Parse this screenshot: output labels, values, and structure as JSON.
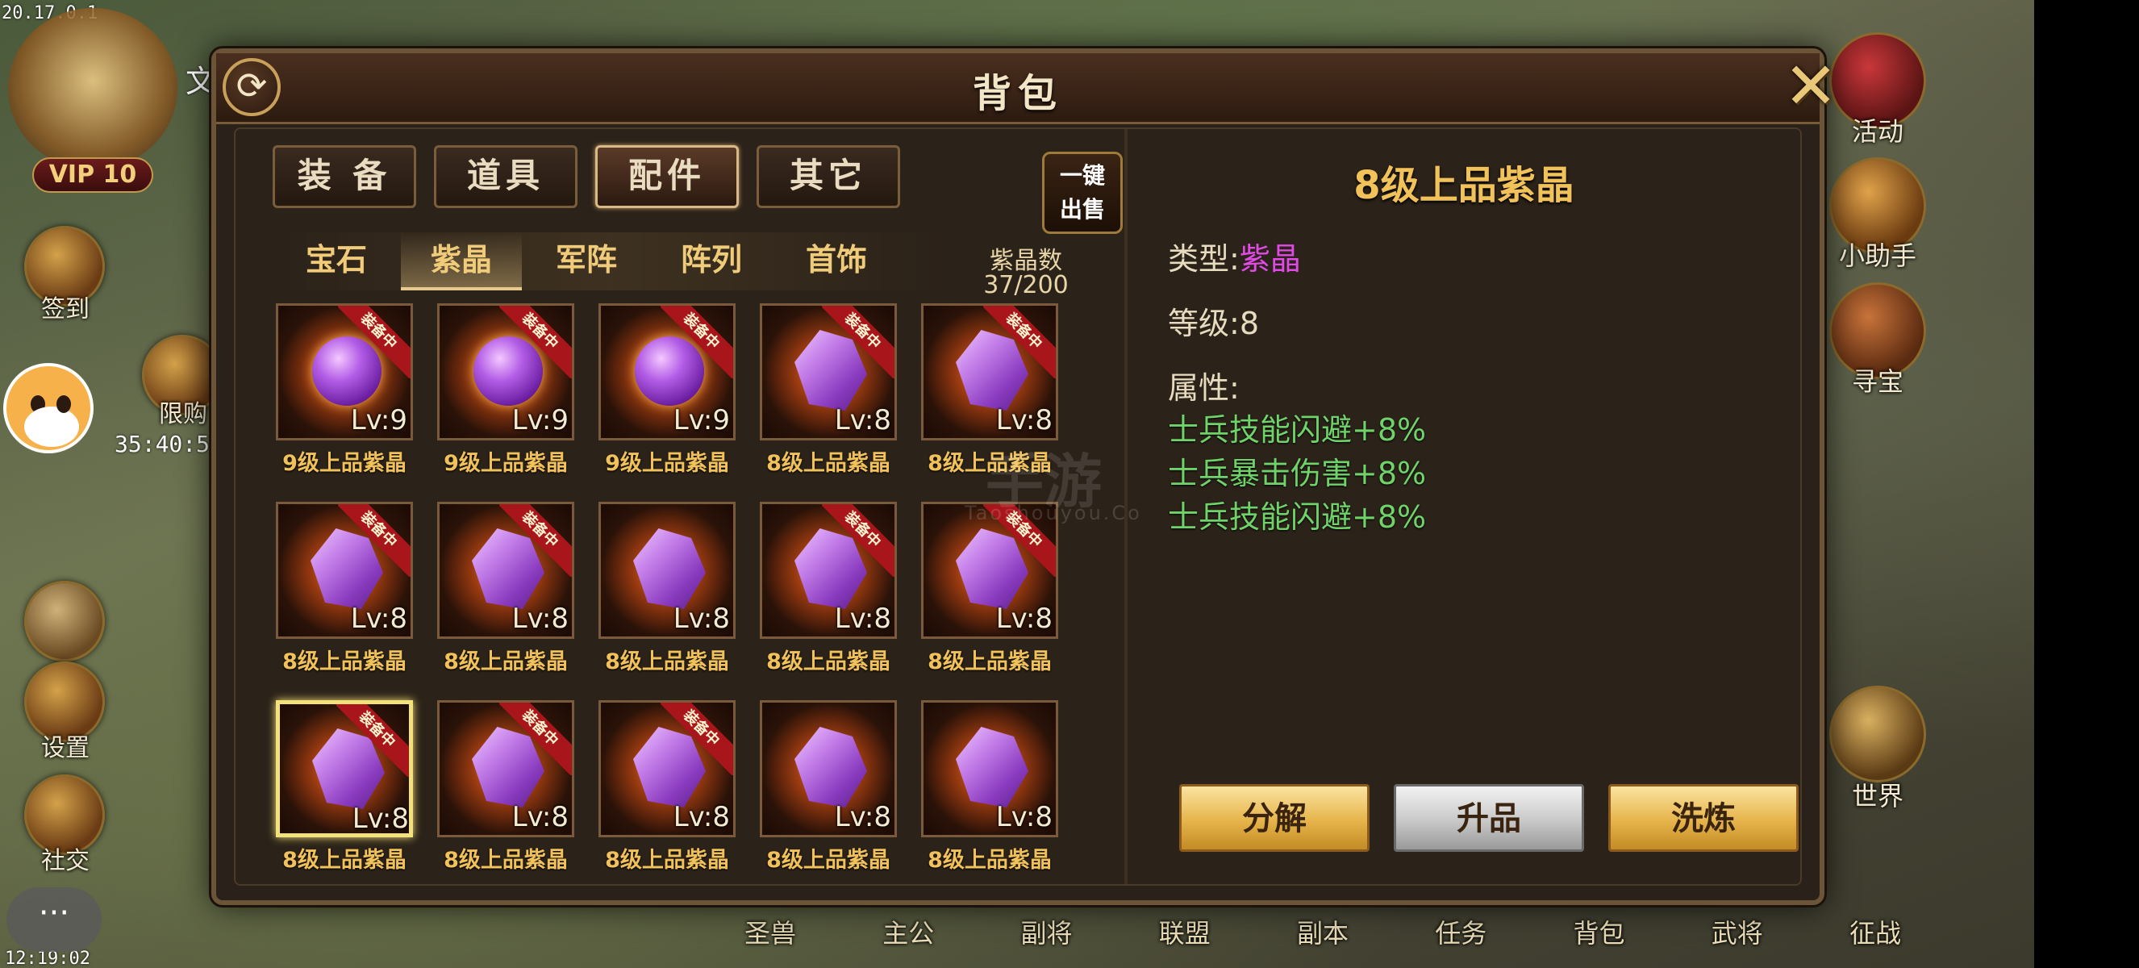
{
  "status": {
    "ip": "20.17.0.1",
    "clock": "12:19:02"
  },
  "hud_left": {
    "vip": "VIP 10",
    "items": [
      {
        "label": "签到",
        "icon": "sign-in-icon"
      },
      {
        "label": "限购",
        "icon": "gift-icon"
      },
      {
        "label": "设置",
        "icon": "settings-icon"
      },
      {
        "label": "社交",
        "icon": "social-icon"
      }
    ],
    "timer": "35:40:5",
    "chat": "···",
    "partial_text": "文"
  },
  "hud_right": [
    {
      "label": "活动",
      "icon": "gift-box-icon"
    },
    {
      "label": "小助手",
      "icon": "assistant-icon"
    },
    {
      "label": "寻宝",
      "icon": "treasure-chest-icon"
    },
    {
      "label": "世界",
      "icon": "world-icon"
    }
  ],
  "bottom_nav": [
    "圣兽",
    "主公",
    "副将",
    "联盟",
    "副本",
    "任务",
    "背包",
    "武将",
    "征战"
  ],
  "dialog": {
    "title": "背包",
    "tabs": [
      "装 备",
      "道具",
      "配件",
      "其它"
    ],
    "active_tab": 2,
    "sell_button": [
      "一键",
      "出售"
    ],
    "subtabs": [
      "宝石",
      "紫晶",
      "军阵",
      "阵列",
      "首饰"
    ],
    "active_subtab": 1,
    "crystal_count_label": "紫晶数",
    "crystal_count": "37/200"
  },
  "items": [
    {
      "name": "9级上品紫晶",
      "lv": "Lv:9",
      "shape": "orb",
      "equipped": true,
      "tag": "装备中"
    },
    {
      "name": "9级上品紫晶",
      "lv": "Lv:9",
      "shape": "orb",
      "equipped": true,
      "tag": "装备中"
    },
    {
      "name": "9级上品紫晶",
      "lv": "Lv:9",
      "shape": "orb",
      "equipped": true,
      "tag": "装备中"
    },
    {
      "name": "8级上品紫晶",
      "lv": "Lv:8",
      "shape": "crystal",
      "equipped": true,
      "tag": "装备中"
    },
    {
      "name": "8级上品紫晶",
      "lv": "Lv:8",
      "shape": "crystal",
      "equipped": true,
      "tag": "装备中"
    },
    {
      "name": "8级上品紫晶",
      "lv": "Lv:8",
      "shape": "crystal",
      "equipped": true,
      "tag": "装备中"
    },
    {
      "name": "8级上品紫晶",
      "lv": "Lv:8",
      "shape": "crystal",
      "equipped": true,
      "tag": "装备中"
    },
    {
      "name": "8级上品紫晶",
      "lv": "Lv:8",
      "shape": "crystal",
      "equipped": false,
      "tag": ""
    },
    {
      "name": "8级上品紫晶",
      "lv": "Lv:8",
      "shape": "crystal",
      "equipped": true,
      "tag": "装备中"
    },
    {
      "name": "8级上品紫晶",
      "lv": "Lv:8",
      "shape": "crystal",
      "equipped": true,
      "tag": "装备中"
    },
    {
      "name": "8级上品紫晶",
      "lv": "Lv:8",
      "shape": "crystal",
      "equipped": true,
      "tag": "装备中",
      "selected": true
    },
    {
      "name": "8级上品紫晶",
      "lv": "Lv:8",
      "shape": "crystal",
      "equipped": true,
      "tag": "装备中"
    },
    {
      "name": "8级上品紫晶",
      "lv": "Lv:8",
      "shape": "crystal",
      "equipped": true,
      "tag": "装备中"
    },
    {
      "name": "8级上品紫晶",
      "lv": "Lv:8",
      "shape": "crystal",
      "equipped": false,
      "tag": ""
    },
    {
      "name": "8级上品紫晶",
      "lv": "Lv:8",
      "shape": "crystal",
      "equipped": false,
      "tag": ""
    }
  ],
  "detail": {
    "name": "8级上品紫晶",
    "type_label": "类型:",
    "type_value": "紫晶",
    "level_label": "等级:",
    "level_value": "8",
    "attr_label": "属性:",
    "attributes": [
      "士兵技能闪避+8%",
      "士兵暴击伤害+8%",
      "士兵技能闪避+8%"
    ],
    "buttons": [
      "分解",
      "升品",
      "洗炼"
    ]
  },
  "watermark": {
    "main": "手游",
    "sub": "Taoshouyou.Co"
  },
  "colors": {
    "gold_text": "#f2c25a",
    "purple": "#e24ae8",
    "attr_green": "#6fd36a",
    "panel_bg": "#2a211a"
  }
}
